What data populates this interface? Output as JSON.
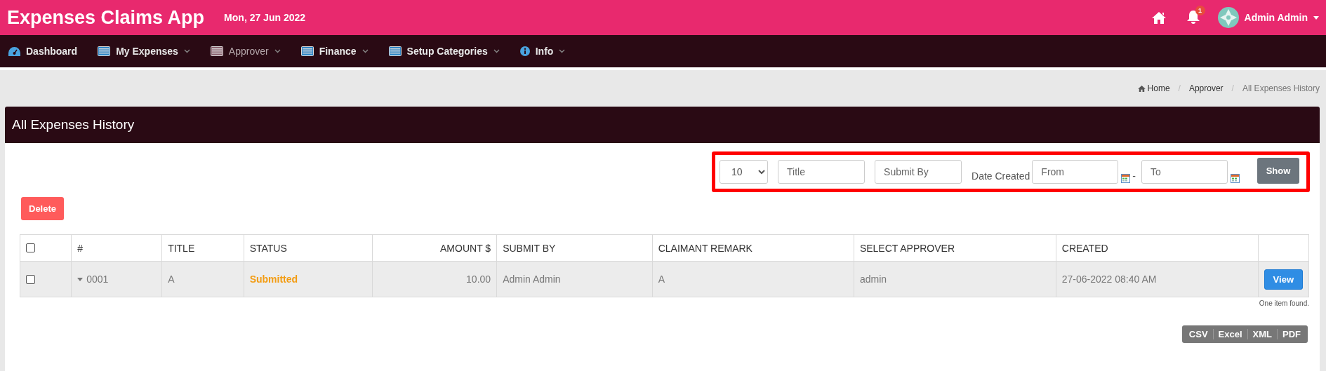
{
  "header": {
    "app_title": "Expenses Claims App",
    "date": "Mon, 27 Jun 2022",
    "notification_count": "1",
    "user_name": "Admin Admin"
  },
  "nav": [
    {
      "label": "Dashboard",
      "selected": false,
      "has_menu": false
    },
    {
      "label": "My Expenses",
      "selected": false,
      "has_menu": true
    },
    {
      "label": "Approver",
      "selected": true,
      "has_menu": true
    },
    {
      "label": "Finance",
      "selected": false,
      "has_menu": true
    },
    {
      "label": "Setup Categories",
      "selected": false,
      "has_menu": true
    },
    {
      "label": "Info",
      "selected": false,
      "has_menu": true
    }
  ],
  "breadcrumb": [
    "Home",
    "Approver",
    "All Expenses History"
  ],
  "breadcrumb_separators": [
    "/",
    "/"
  ],
  "panel": {
    "title": "All Expenses History"
  },
  "filters": {
    "page_size": "10",
    "title_placeholder": "Title",
    "submit_by_placeholder": "Submit By",
    "date_label": "Date Created",
    "from_placeholder": "From",
    "separator": "-",
    "to_placeholder": "To",
    "show_button": "Show"
  },
  "delete_button": "Delete",
  "table": {
    "columns": [
      {
        "kind": "checkbox"
      },
      {
        "label": "#",
        "kind": "text"
      },
      {
        "label": "TITLE",
        "kind": "text"
      },
      {
        "label": "STATUS",
        "kind": "text"
      },
      {
        "label": "AMOUNT $",
        "kind": "text"
      },
      {
        "label": "SUBMIT BY",
        "kind": "text"
      },
      {
        "label": "CLAIMANT REMARK",
        "kind": "text"
      },
      {
        "label": "SELECT APPROVER",
        "kind": "text"
      },
      {
        "label": "CREATED",
        "kind": "text"
      },
      {
        "kind": "action"
      }
    ],
    "header_checked": false,
    "rows": [
      {
        "checked": false,
        "expanded": false,
        "number": "0001",
        "title": "A",
        "status": {
          "text": "Submitted",
          "color": "#f39c12"
        },
        "amount": "10.00",
        "submit_by": "Admin Admin",
        "remark": "A",
        "approver": "admin",
        "created": "27-06-2022 08:40 AM",
        "action": "View"
      }
    ]
  },
  "summary": "One item found.",
  "export_buttons": [
    "CSV",
    "Excel",
    "XML",
    "PDF"
  ]
}
